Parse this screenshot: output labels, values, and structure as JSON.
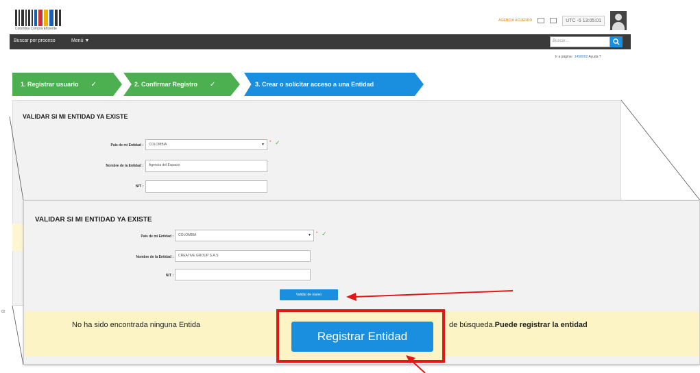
{
  "header": {
    "logo_text": "Colombia Compra Eficiente",
    "user_link": "AGENCIA ACUERDO",
    "clock": "UTC -5 13:05:01",
    "colors": {
      "accent": "#1a8fe0",
      "success": "#4caf50",
      "highlight": "#e01818"
    }
  },
  "nav": {
    "items": [
      {
        "label": "Buscar por proceso"
      },
      {
        "label": "Menú ▼"
      }
    ],
    "search_placeholder": "Buscar..."
  },
  "subheader": {
    "prefix": "Ir a página :",
    "page_link": "1450002",
    "help": "Ayuda ?"
  },
  "steps": [
    {
      "label": "1. Registrar usuario",
      "done": true
    },
    {
      "label": "2. Confirmar Registro",
      "done": true
    },
    {
      "label": "3. Crear o solicitar acceso a una Entidad",
      "done": false
    }
  ],
  "background_form": {
    "title": "VALIDAR SI MI ENTIDAD YA EXISTE",
    "country_label": "País de mi Entidad :",
    "country_value": "COLOMBIA",
    "name_label": "Nombre de la Entidad :",
    "name_value": "Agencia del Espacio",
    "nit_label": "NIT :",
    "nit_value": ""
  },
  "zoomed_form": {
    "title": "VALIDAR SI MI ENTIDAD YA EXISTE",
    "country_label": "País de mi Entidad :",
    "country_value": "COLOMBIA",
    "name_label": "Nombre de la Entidad :",
    "name_value": "CREATIVE GROUP S.A.S",
    "nit_label": "NIT :",
    "nit_value": "",
    "validate_label": "Validar de nuevo",
    "result_text_start": "No ha sido encontrada ninguna Entida",
    "result_text_end": "de búsqueda.",
    "result_text_bold": "Puede registrar la entidad",
    "register_label": "Registrar Entidad"
  },
  "side_text": "02"
}
